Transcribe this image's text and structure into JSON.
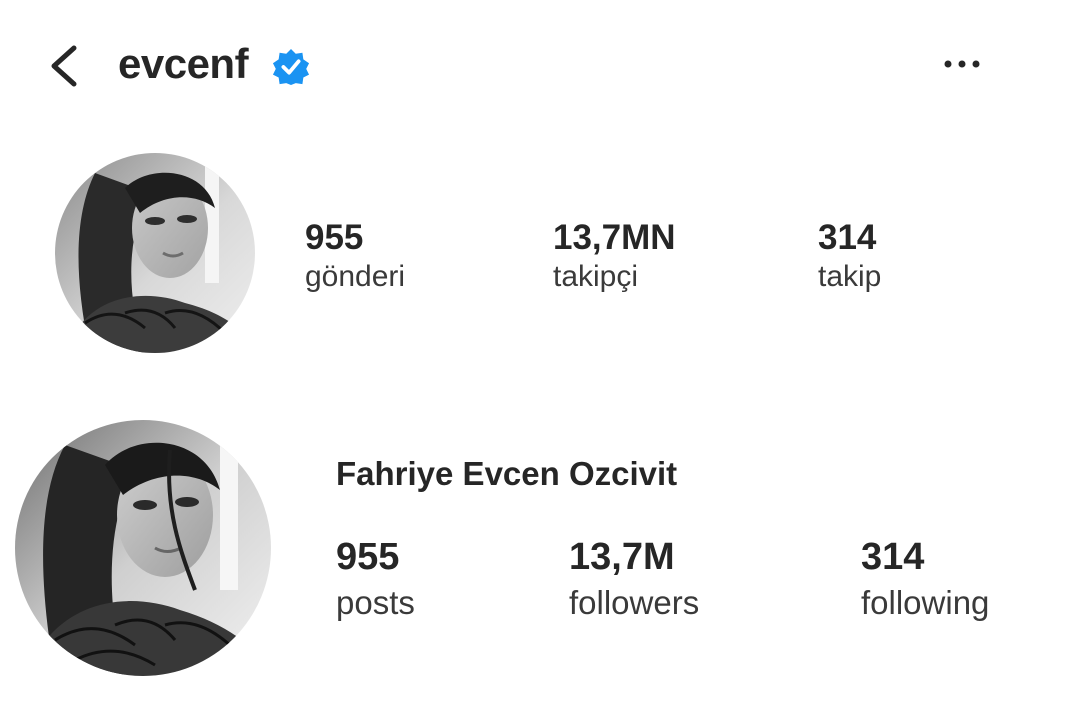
{
  "header": {
    "username": "evcenf",
    "verified": true,
    "icons": {
      "back": "chevron-left-icon",
      "verified": "verified-badge-icon",
      "more": "more-horizontal-icon"
    }
  },
  "profile_tr": {
    "stats": [
      {
        "value": "955",
        "label": "gönderi"
      },
      {
        "value": "13,7MN",
        "label": "takipçi"
      },
      {
        "value": "314",
        "label": "takip"
      }
    ]
  },
  "profile_en": {
    "full_name": "Fahriye Evcen Ozcivit",
    "stats": [
      {
        "value": "955",
        "label": "posts"
      },
      {
        "value": "13,7M",
        "label": "followers"
      },
      {
        "value": "314",
        "label": "following"
      }
    ]
  },
  "colors": {
    "verified_blue": "#1a93f2",
    "text": "#262626"
  }
}
